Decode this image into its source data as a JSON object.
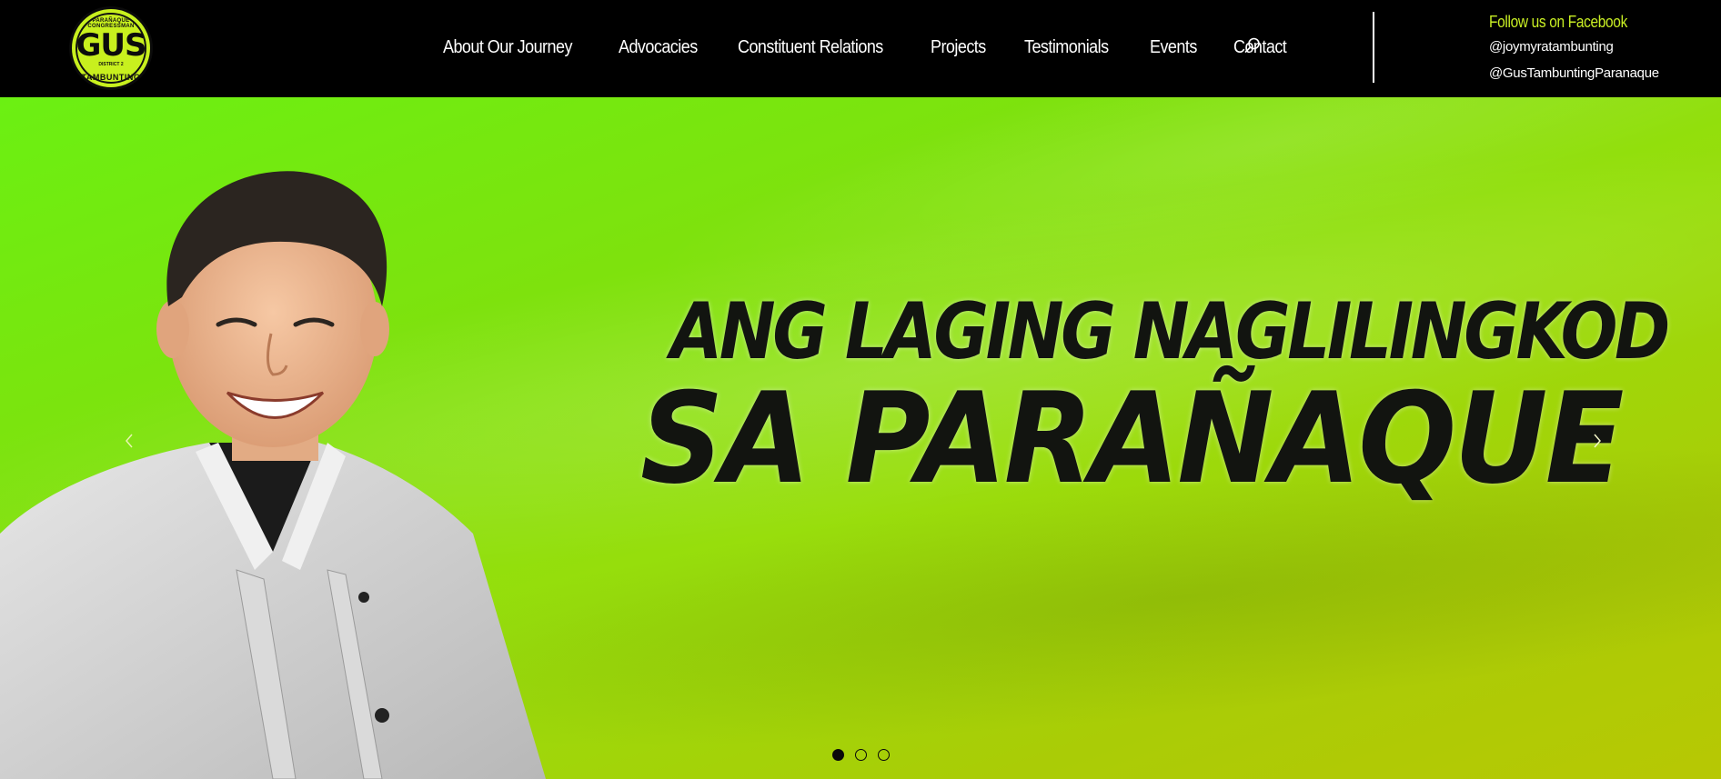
{
  "header": {
    "logo": {
      "name": "GUS",
      "top_text": "PARAÑAQUE CONGRESSMAN",
      "small_text": "DISTRICT 2",
      "bottom_text": "TAMBUNTING"
    },
    "nav": [
      {
        "label": "About Our Journey"
      },
      {
        "label": "Advocacies"
      },
      {
        "label": "Constituent Relations"
      },
      {
        "label": "Projects"
      },
      {
        "label": "Testimonials"
      },
      {
        "label": "Events"
      },
      {
        "label": "Contact"
      }
    ],
    "search_icon": "search-icon",
    "social": {
      "title": "Follow us on Facebook",
      "links": [
        "@joymyratambunting",
        "@GusTambuntingParanaque"
      ]
    }
  },
  "hero": {
    "headline_line1": "ANG LAGING NAGLILINGKOD",
    "headline_line2": "SA PARAÑAQUE",
    "slides": 3,
    "active_slide": 1,
    "colors": {
      "accent": "#c8ee24",
      "bg_start": "#6bf012",
      "bg_end": "#b7c804"
    }
  }
}
